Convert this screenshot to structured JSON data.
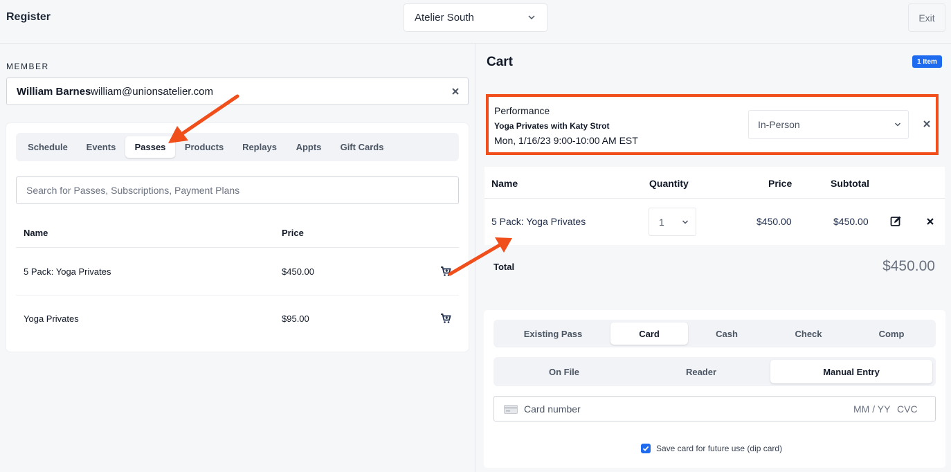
{
  "header": {
    "title": "Register",
    "location": "Atelier South",
    "exit_label": "Exit"
  },
  "member": {
    "label": "MEMBER",
    "name": "William Barnes",
    "email": "william@unionsatelier.com"
  },
  "catalog": {
    "tabs": [
      {
        "label": "Schedule"
      },
      {
        "label": "Events"
      },
      {
        "label": "Passes"
      },
      {
        "label": "Products"
      },
      {
        "label": "Replays"
      },
      {
        "label": "Appts"
      },
      {
        "label": "Gift Cards"
      }
    ],
    "active_tab": "Passes",
    "search_placeholder": "Search for Passes, Subscriptions, Payment Plans",
    "columns": {
      "name": "Name",
      "price": "Price"
    },
    "rows": [
      {
        "name": "5 Pack: Yoga Privates",
        "price": "$450.00"
      },
      {
        "name": "Yoga Privates",
        "price": "$95.00"
      }
    ]
  },
  "cart": {
    "title": "Cart",
    "badge": "1 Item",
    "booking": {
      "type": "Performance",
      "event": "Yoga Privates with Katy Strot",
      "when": "Mon, 1/16/23 9:00-10:00 AM EST",
      "attendance": "In-Person"
    },
    "columns": {
      "name": "Name",
      "quantity": "Quantity",
      "price": "Price",
      "subtotal": "Subtotal"
    },
    "items": [
      {
        "name": "5 Pack: Yoga Privates",
        "quantity": "1",
        "price": "$450.00",
        "subtotal": "$450.00"
      }
    ],
    "total_label": "Total",
    "total_value": "$450.00"
  },
  "payment": {
    "methods": [
      {
        "label": "Existing Pass"
      },
      {
        "label": "Card"
      },
      {
        "label": "Cash"
      },
      {
        "label": "Check"
      },
      {
        "label": "Comp"
      }
    ],
    "active_method": "Card",
    "card_modes": [
      {
        "label": "On File"
      },
      {
        "label": "Reader"
      },
      {
        "label": "Manual Entry"
      }
    ],
    "active_card_mode": "Manual Entry",
    "card_number_placeholder": "Card number",
    "expiry_placeholder": "MM / YY",
    "cvc_placeholder": "CVC",
    "save_card_label": "Save card for future use (dip card)",
    "save_card_checked": true
  },
  "colors": {
    "accent": "#1e6bf0",
    "annotation": "#f04e1b"
  }
}
